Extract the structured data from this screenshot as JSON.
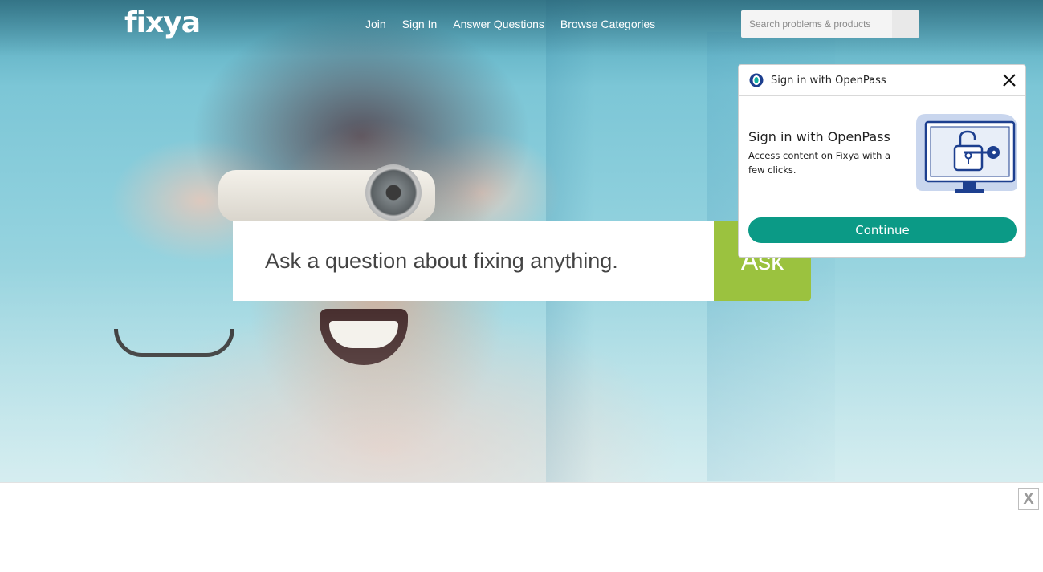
{
  "header": {
    "logo_text": "fixya",
    "nav": [
      {
        "label": "Join"
      },
      {
        "label": "Sign In"
      },
      {
        "label": "Answer Questions"
      },
      {
        "label": "Browse Categories"
      }
    ],
    "search": {
      "placeholder": "Search problems & products",
      "value": ""
    }
  },
  "hero": {
    "ask_placeholder": "Ask a question about fixing anything.",
    "ask_button_label": "Ask"
  },
  "openpass_popup": {
    "header_text": "Sign in with OpenPass",
    "title": "Sign in with OpenPass",
    "description": "Access content on Fixya with a few clicks.",
    "continue_label": "Continue",
    "icons": [
      "openpass-logo-icon",
      "close-icon",
      "monitor-lock-key-icon"
    ]
  },
  "ad_bar": {
    "close_label": "X"
  },
  "colors": {
    "ask_button": "#9bc23f",
    "continue_button": "#0b9a86",
    "openpass_blue": "#1d3f8f"
  }
}
